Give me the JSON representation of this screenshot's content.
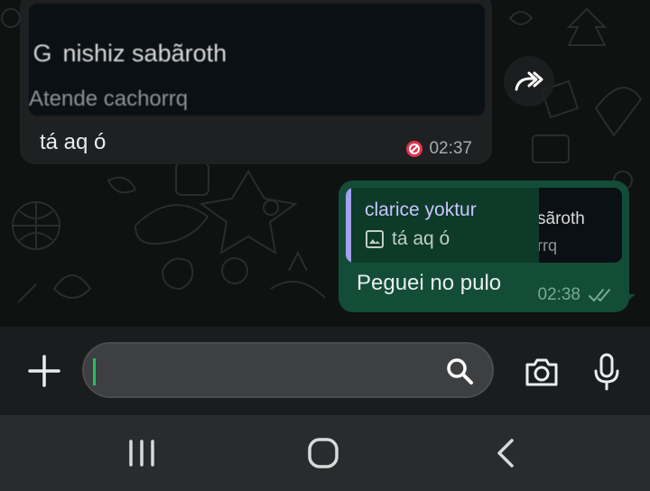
{
  "incoming_message": {
    "preview": {
      "glyph": "G",
      "title": "nishiz sabãroth",
      "subtitle": "Atende cachorrq"
    },
    "text": "tá aq ó",
    "time": "02:37",
    "status_icon": "blocked-icon"
  },
  "forward_button": {
    "icon": "forward-icon"
  },
  "outgoing_message": {
    "reply": {
      "sender": "clarice yoktur",
      "quoted_text": "tá aq ó",
      "quoted_icon": "image-icon",
      "thumbnail_title": "sãroth",
      "thumbnail_subtitle": "rrq"
    },
    "text": "Peguei no pulo",
    "time": "02:38",
    "status_icon": "double-check-icon"
  },
  "input_bar": {
    "placeholder": "",
    "value": "",
    "icons": [
      "plus-icon",
      "search-icon",
      "camera-icon",
      "mic-icon"
    ]
  },
  "nav_bar": {
    "icons": [
      "recent-apps-icon",
      "home-icon",
      "back-icon"
    ]
  },
  "colors": {
    "chat_background": "#101111",
    "incoming_bubble": "#1f2022",
    "outgoing_bubble": "#134d37",
    "reply_accent": "#a3a1f0",
    "cursor": "#21c063",
    "blocked_red": "#e3334e"
  }
}
